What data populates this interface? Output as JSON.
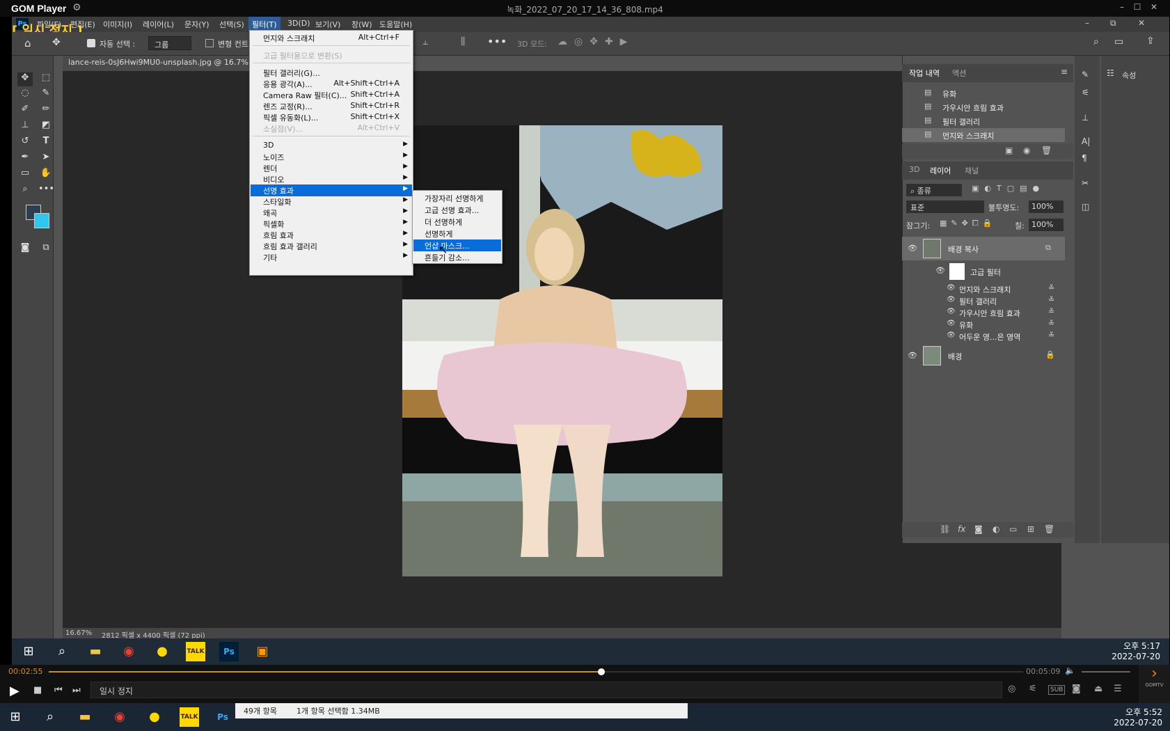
{
  "gom": {
    "app_name": "GOM Player",
    "file_name": "녹화_2022_07_20_17_14_36_808.mp4",
    "paused_overlay": "[ 일시 정지 ]",
    "current_time": "00:02:55",
    "total_time": "00:05:09",
    "progress_fraction": 0.567,
    "status_text": "일시 정지",
    "sub_label": "SUB",
    "brand": "GOMTV"
  },
  "ps": {
    "menus": [
      "파일(F)",
      "편집(E)",
      "이미지(I)",
      "레이어(L)",
      "문자(Y)",
      "선택(S)",
      "필터(T)",
      "3D(D)",
      "보기(V)",
      "창(W)",
      "도움말(H)"
    ],
    "options": {
      "auto_select_label": "자동 선택 :",
      "auto_select_value": "그룹",
      "transform_label": "변형 컨트",
      "three_d_mode": "3D 모드:"
    },
    "doc_tab": "lance-reis-0sJ6Hwi9MU0-unsplash.jpg @ 16.7% (b",
    "status_zoom": "16.67%",
    "status_dims": "2812 픽셀 x 4400 픽셀 (72 ppi)"
  },
  "filter_menu": {
    "items": [
      {
        "label": "먼지와 스크래치",
        "shortcut": "Alt+Ctrl+F"
      },
      {
        "label": "고급 필터용으로 변환(S)",
        "shortcut": "",
        "disabled": true
      },
      {
        "label": "필터 갤러리(G)...",
        "shortcut": ""
      },
      {
        "label": "응용 광각(A)...",
        "shortcut": "Alt+Shift+Ctrl+A"
      },
      {
        "label": "Camera Raw 필터(C)...",
        "shortcut": "Shift+Ctrl+A"
      },
      {
        "label": "렌즈 교정(R)...",
        "shortcut": "Shift+Ctrl+R"
      },
      {
        "label": "픽셀 유동화(L)...",
        "shortcut": "Shift+Ctrl+X"
      },
      {
        "label": "소실점(V)...",
        "shortcut": "Alt+Ctrl+V",
        "disabled": true
      },
      {
        "label": "3D"
      },
      {
        "label": "노이즈"
      },
      {
        "label": "렌더"
      },
      {
        "label": "비디오"
      },
      {
        "label": "선명 효과"
      },
      {
        "label": "스타일화"
      },
      {
        "label": "왜곡"
      },
      {
        "label": "픽셀화"
      },
      {
        "label": "흐림 효과"
      },
      {
        "label": "흐림 효과 갤러리"
      },
      {
        "label": "기타"
      }
    ]
  },
  "sharpen_submenu": [
    "가장자리 선명하게",
    "고급 선명 효과...",
    "더 선명하게",
    "선명하게",
    "언샵 마스크...",
    "흔들기 감소..."
  ],
  "history": {
    "tabs": [
      "작업 내역",
      "액션"
    ],
    "items": [
      "유화",
      "가우시안 흐림 효과",
      "필터 갤러리",
      "먼지와 스크래치"
    ]
  },
  "layers": {
    "tabs": [
      "3D",
      "레이어",
      "채널"
    ],
    "kind": "종류",
    "blend": "표준",
    "opacity_label": "불투명도:",
    "opacity": "100%",
    "lock_label": "잠그기:",
    "fill_label": "칠:",
    "fill": "100%",
    "layer_copy": "배경 복사",
    "smart_filters": "고급 필터",
    "filters": [
      "먼지와 스크래치",
      "필터 갤러리",
      "가우시안 흐림 효과",
      "유화",
      "어두운 영...은 영역"
    ],
    "background": "배경"
  },
  "properties_label": "속성",
  "inner_clock": {
    "time": "오후 5:17",
    "date": "2022-07-20"
  },
  "outer_clock": {
    "time": "오후 5:52",
    "date": "2022-07-20"
  },
  "explorer_status": {
    "count": "49개 항목",
    "selected": "1개 항목 선택함 1.34MB"
  },
  "colors": {
    "accent": "#0a6cd9",
    "progress": "#d98a1e",
    "ps_bg": "#535353"
  }
}
